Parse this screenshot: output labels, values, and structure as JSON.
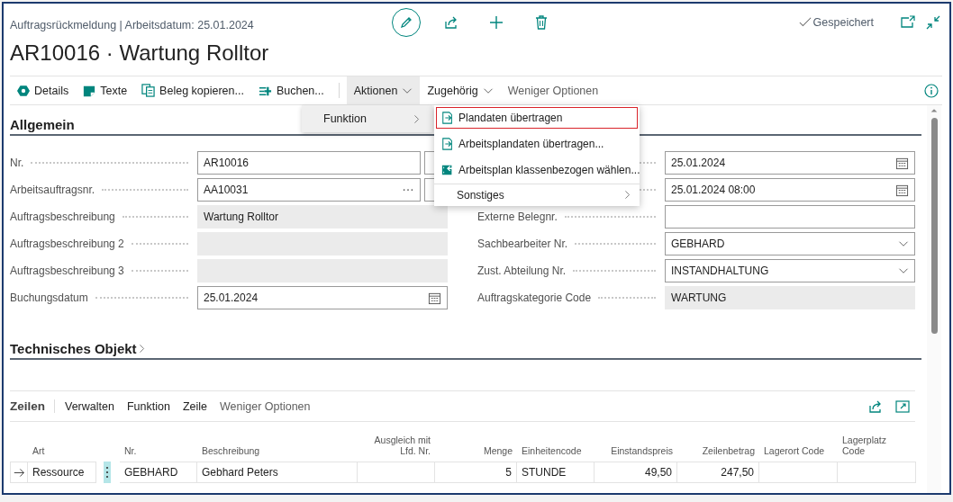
{
  "header": {
    "breadcrumb": "Auftragsrückmeldung | Arbeitsdatum: 25.01.2024",
    "title": "AR10016 · Wartung Rolltor",
    "status": "Gespeichert"
  },
  "action_bar": {
    "items": [
      {
        "label": "Details",
        "kind": "command",
        "expanded": false
      },
      {
        "label": "Texte",
        "kind": "command",
        "expanded": false
      },
      {
        "label": "Beleg kopieren...",
        "kind": "command",
        "expanded": false
      },
      {
        "label": "Buchen...",
        "kind": "command",
        "expanded": false
      },
      {
        "label": "Aktionen",
        "kind": "menu",
        "expanded": true
      },
      {
        "label": "Zugehörig",
        "kind": "menu",
        "expanded": false
      },
      {
        "label": "Weniger Optionen",
        "kind": "link",
        "expanded": false
      }
    ]
  },
  "open_menu": {
    "items": [
      {
        "label": "Funktion"
      }
    ]
  },
  "submenu": {
    "items": [
      {
        "label": "Plandaten übertragen",
        "kind": "action",
        "selected": true
      },
      {
        "label": "Arbeitsplandaten übertragen...",
        "kind": "action",
        "selected": false
      },
      {
        "label": "Arbeitsplan klassenbezogen wählen...",
        "kind": "action",
        "selected": false
      },
      {
        "label": "Sonstiges",
        "kind": "submenu",
        "selected": false
      }
    ]
  },
  "general": {
    "title": "Allgemein",
    "left_fields": [
      {
        "label": "Nr.",
        "value": "AR10016",
        "kind": "lookup"
      },
      {
        "label": "Arbeitsauftragsnr.",
        "value": "AA10031",
        "kind": "assist_lookup"
      },
      {
        "label": "Auftragsbeschreibung",
        "value": "Wartung Rolltor",
        "kind": "readonly"
      },
      {
        "label": "Auftragsbeschreibung 2",
        "kind": "readonly"
      },
      {
        "label": "Auftragsbeschreibung 3",
        "kind": "readonly"
      },
      {
        "label": "Buchungsdatum",
        "value": "25.01.2024",
        "kind": "date"
      }
    ],
    "right_fields": [
      {
        "value": "25.01.2024",
        "kind": "date"
      },
      {
        "value": "25.01.2024 08:00",
        "kind": "date"
      },
      {
        "label": "Externe Belegnr.",
        "kind": "text"
      },
      {
        "label": "Sachbearbeiter Nr.",
        "value": "GEBHARD",
        "kind": "select"
      },
      {
        "label": "Zust. Abteilung Nr.",
        "value": "INSTANDHALTUNG",
        "kind": "select"
      },
      {
        "label": "Auftragskategorie Code",
        "value": "WARTUNG",
        "kind": "readonly"
      }
    ]
  },
  "technical_object": {
    "title": "Technisches Objekt",
    "expanded": false
  },
  "lines": {
    "title": "Zeilen",
    "actions": [
      {
        "label": "Verwalten",
        "kind": "command"
      },
      {
        "label": "Funktion",
        "kind": "command"
      },
      {
        "label": "Zeile",
        "kind": "command"
      },
      {
        "label": "Weniger Optionen",
        "kind": "link"
      }
    ],
    "table": {
      "columns": [
        {
          "label": "Art",
          "numeric": false
        },
        {
          "label": "Nr.",
          "numeric": false
        },
        {
          "label": "Beschreibung",
          "numeric": false
        },
        {
          "label": "Ausgleich mit Lfd. Nr.",
          "numeric": true
        },
        {
          "label": "Menge",
          "numeric": true
        },
        {
          "label": "Einheitencode",
          "numeric": false
        },
        {
          "label": "Einstandspreis",
          "numeric": true
        },
        {
          "label": "Zeilenbetrag",
          "numeric": true
        },
        {
          "label": "Lagerort Code",
          "numeric": false
        },
        {
          "label": "Lagerplatz Code",
          "numeric": false
        }
      ],
      "rows": [
        {
          "selected": true,
          "cells": [
            "Ressource",
            "GEBHARD",
            "Gebhard Peters",
            null,
            "5",
            "STUNDE",
            "49,50",
            "247,50",
            null,
            null
          ]
        }
      ]
    }
  }
}
